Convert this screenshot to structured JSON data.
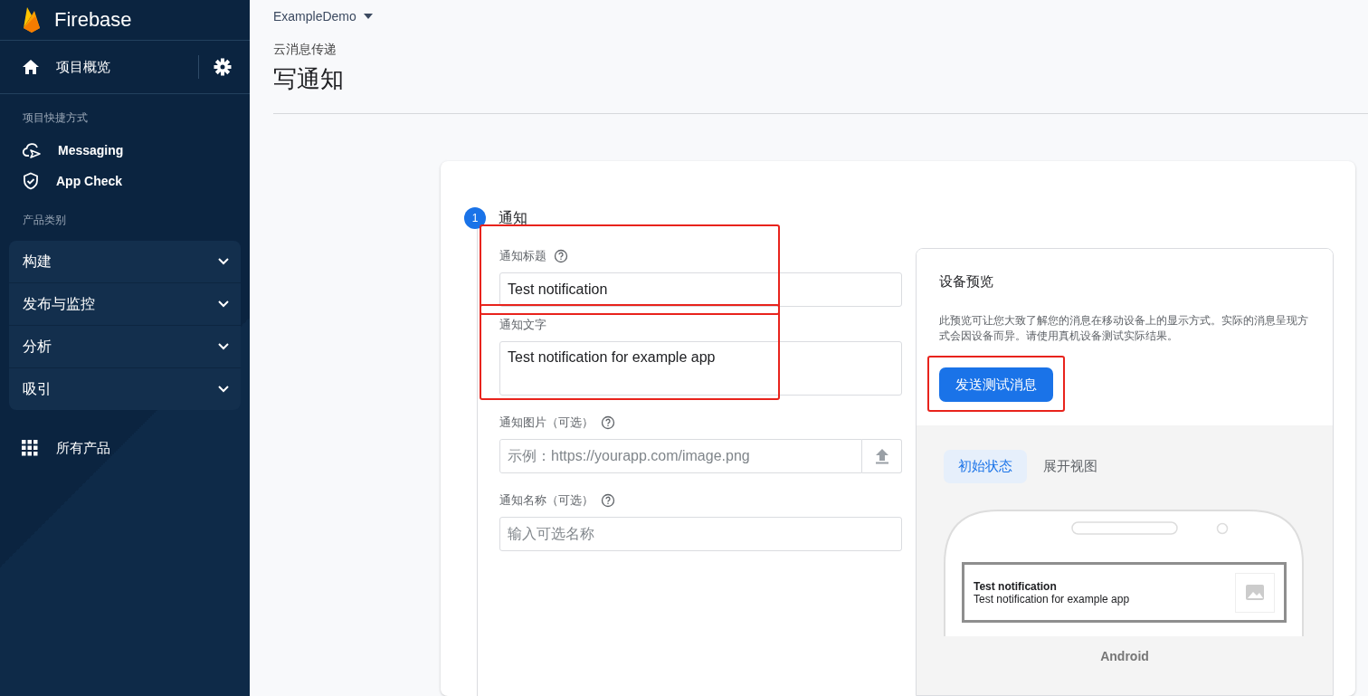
{
  "sidebar": {
    "brand": "Firebase",
    "overview": "项目概览",
    "shortcuts_heading": "项目快捷方式",
    "shortcuts": [
      {
        "label": "Messaging",
        "kind": "cloud"
      },
      {
        "label": "App Check",
        "kind": "shield"
      }
    ],
    "categories_heading": "产品类别",
    "categories": [
      {
        "label": "构建",
        "expanded": false
      },
      {
        "label": "发布与监控",
        "expanded": false
      },
      {
        "label": "分析",
        "expanded": false
      },
      {
        "label": "吸引",
        "expanded": false
      }
    ],
    "all_products": "所有产品"
  },
  "header": {
    "project": "ExampleDemo",
    "breadcrumb": "云消息传递",
    "title": "写通知"
  },
  "step": {
    "number": "1",
    "title": "通知"
  },
  "fields": [
    {
      "label": "通知标题",
      "help": true,
      "kind": "text",
      "value": "Test notification",
      "highlighted": true
    },
    {
      "label": "通知文字",
      "help": false,
      "kind": "textarea",
      "value": "Test notification for example app",
      "highlighted": true
    },
    {
      "label": "通知图片（可选）",
      "help": true,
      "kind": "upload",
      "placeholder": "示例：https://yourapp.com/image.png",
      "highlighted": false
    },
    {
      "label": "通知名称（可选）",
      "help": true,
      "kind": "text",
      "placeholder": "输入可选名称",
      "highlighted": false
    }
  ],
  "preview": {
    "title": "设备预览",
    "description": "此预览可让您大致了解您的消息在移动设备上的显示方式。实际的消息呈现方式会因设备而异。请使用真机设备测试实际结果。",
    "send_button": {
      "label": "发送测试消息",
      "highlighted": true
    },
    "tabs": [
      {
        "label": "初始状态",
        "selected": true
      },
      {
        "label": "展开视图",
        "selected": false
      }
    ],
    "notification": {
      "title": "Test notification",
      "body": "Test notification for example app"
    },
    "platform": "Android"
  }
}
